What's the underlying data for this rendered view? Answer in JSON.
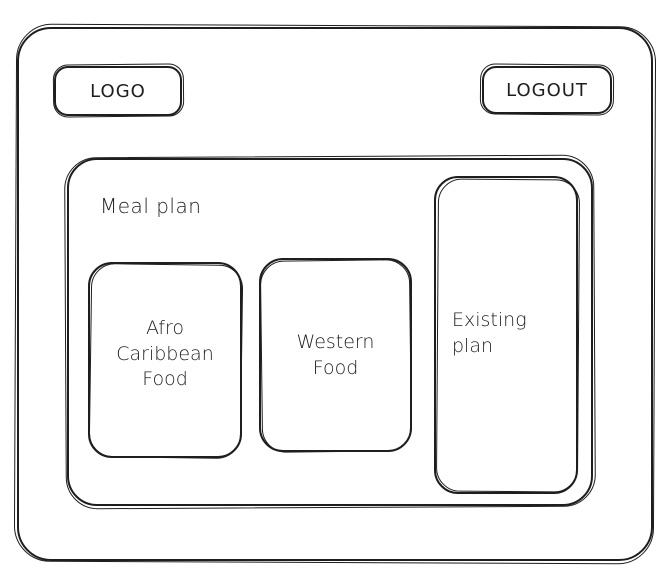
{
  "header": {
    "logo_label": "LOGO",
    "logout_label": "LOGOUT"
  },
  "meal_plan": {
    "title": "Meal plan",
    "cards": [
      {
        "label": "Afro\nCaribbean\nFood"
      },
      {
        "label": "Western\nFood"
      },
      {
        "label": "Existing\nplan"
      }
    ]
  },
  "colors": {
    "stroke": "#1e1e1e",
    "background": "#ffffff"
  }
}
